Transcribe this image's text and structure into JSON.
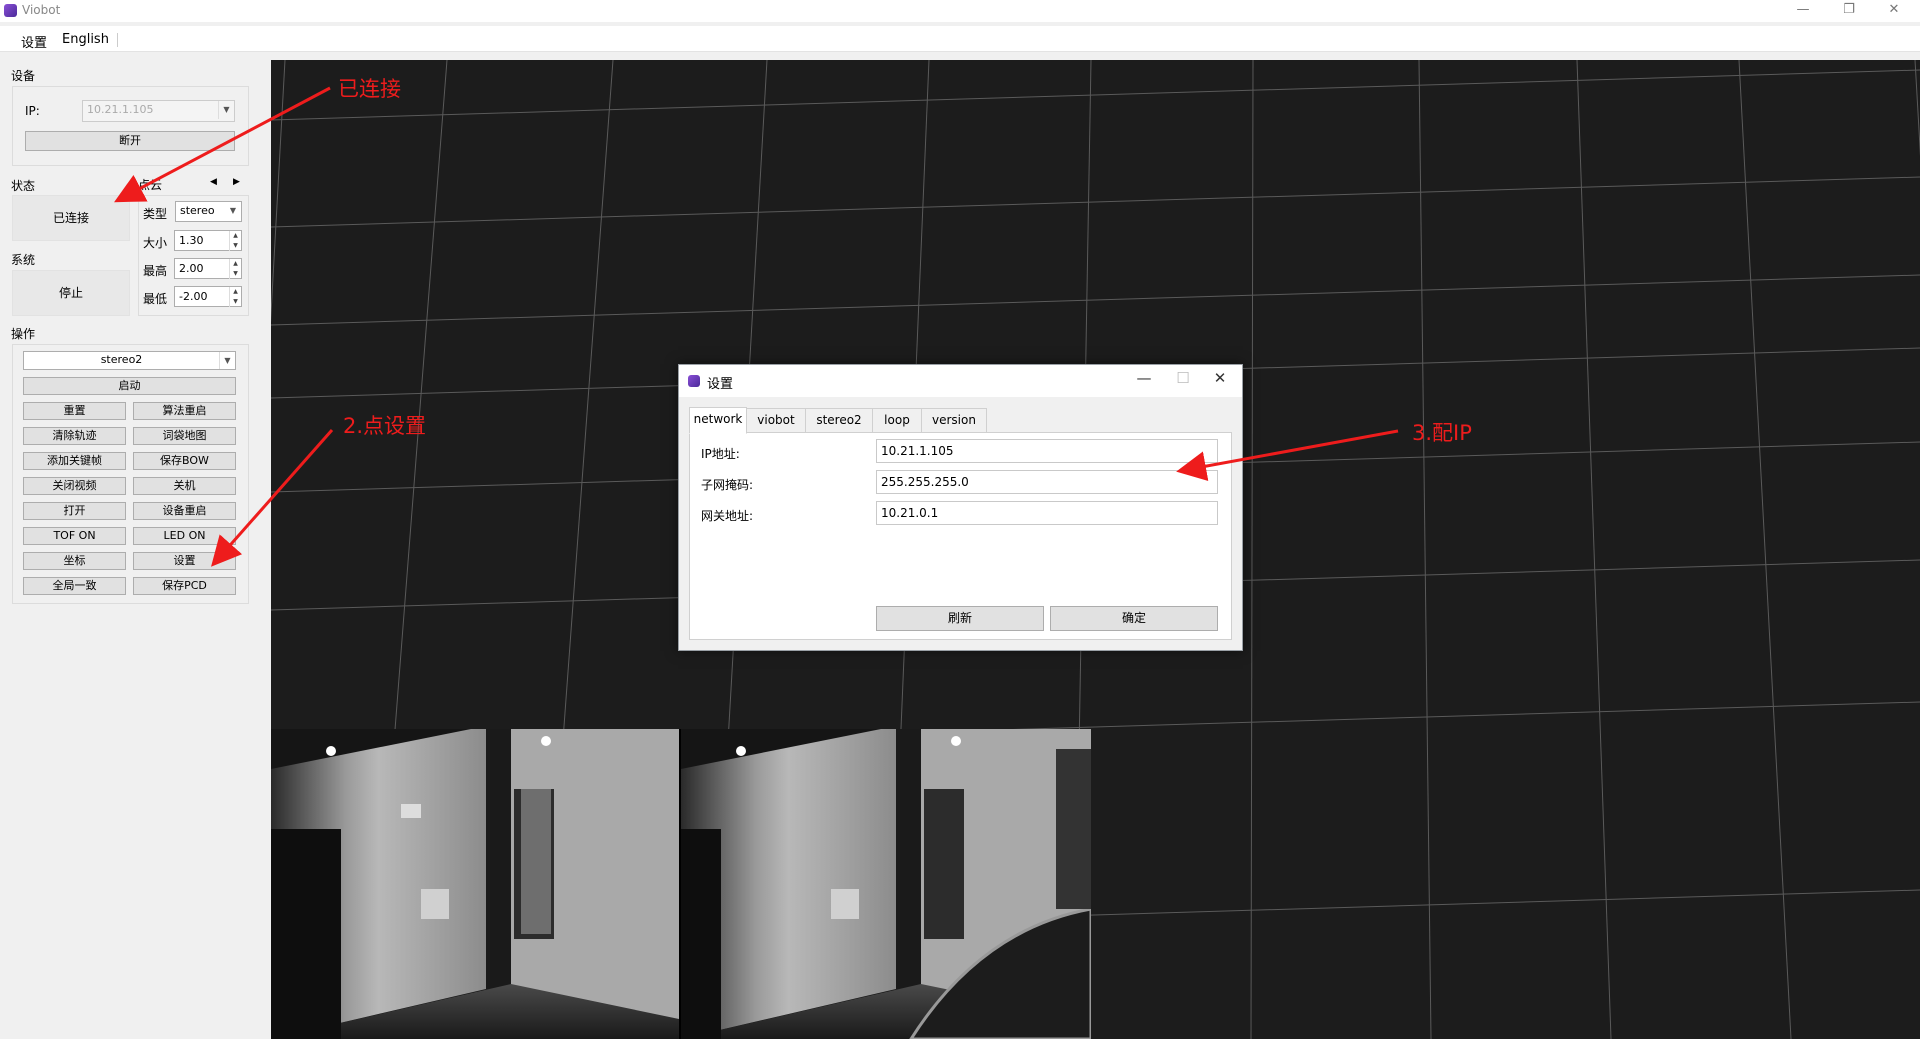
{
  "window": {
    "title": "Viobot",
    "minimize": "—",
    "restore": "❐",
    "close": "✕"
  },
  "menubar": {
    "items": [
      "设置",
      "English"
    ]
  },
  "device": {
    "section": "设备",
    "ip_label": "IP:",
    "ip_value": "10.21.1.105",
    "disconnect_label": "断开"
  },
  "status": {
    "section": "状态",
    "button": "已连接"
  },
  "system": {
    "section": "系统",
    "button": "停止"
  },
  "pointcloud": {
    "section": "点云",
    "type_label": "类型",
    "type_value": "stereo",
    "size_label": "大小",
    "size_value": "1.30",
    "max_label": "最高",
    "max_value": "2.00",
    "min_label": "最低",
    "min_value": "-2.00"
  },
  "operation": {
    "section": "操作",
    "mode_value": "stereo2",
    "start_label": "启动",
    "buttons": [
      [
        "重置",
        "算法重启"
      ],
      [
        "清除轨迹",
        "词袋地图"
      ],
      [
        "添加关键帧",
        "保存BOW"
      ],
      [
        "关闭视频",
        "关机"
      ],
      [
        "打开",
        "设备重启"
      ],
      [
        "TOF ON",
        "LED ON"
      ],
      [
        "坐标",
        "设置"
      ],
      [
        "全局一致",
        "保存PCD"
      ]
    ]
  },
  "dialog": {
    "title": "设置",
    "minimize": "—",
    "maximize": "☐",
    "close": "✕",
    "tabs": [
      "network",
      "viobot",
      "stereo2",
      "loop",
      "version"
    ],
    "active_tab": "network",
    "fields": [
      {
        "label": "IP地址:",
        "value": "10.21.1.105"
      },
      {
        "label": "子网掩码:",
        "value": "255.255.255.0"
      },
      {
        "label": "网关地址:",
        "value": "10.21.0.1"
      }
    ],
    "refresh_label": "刷新",
    "ok_label": "确定"
  },
  "annotations": {
    "connected": "已连接",
    "step2": "2.点设置",
    "step3": "3.配IP",
    "color": "#ee1c1c"
  },
  "colors": {
    "viewport_bg": "#1c1c1c",
    "grid_line": "#5a5a5a",
    "accent": "#6b3fc0"
  }
}
